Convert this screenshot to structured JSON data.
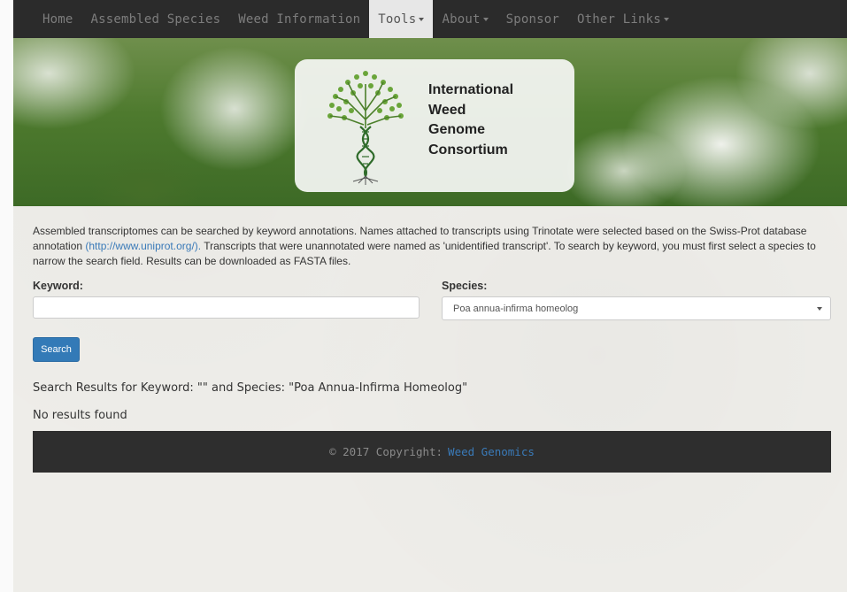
{
  "nav": {
    "items": [
      {
        "label": "Home",
        "dropdown": false
      },
      {
        "label": "Assembled Species",
        "dropdown": false
      },
      {
        "label": "Weed Information",
        "dropdown": false
      },
      {
        "label": "Tools",
        "dropdown": true,
        "active": true
      },
      {
        "label": "About",
        "dropdown": true
      },
      {
        "label": "Sponsor",
        "dropdown": false
      },
      {
        "label": "Other Links",
        "dropdown": true
      }
    ]
  },
  "banner": {
    "logo_lines": [
      "International",
      "Weed",
      "Genome",
      "Consortium"
    ]
  },
  "intro": {
    "text_before_link": "Assembled transcriptomes can be searched by keyword annotations. Names attached to transcripts using Trinotate were selected based on the Swiss-Prot database annotation ",
    "link_text": "(http://www.uniprot.org/).",
    "text_after_link": " Transcripts that were unannotated were named as 'unidentified transcript'. To search by keyword, you must first select a species to narrow the search field. Results can be downloaded as FASTA files."
  },
  "form": {
    "keyword_label": "Keyword:",
    "keyword_value": "",
    "species_label": "Species:",
    "species_selected": "Poa annua-infirma homeolog",
    "search_button": "Search"
  },
  "results": {
    "title": "Search Results for Keyword: \"\" and Species: \"Poa Annua-Infirma Homeolog\"",
    "empty_message": "No results found"
  },
  "footer": {
    "copyright": "© 2017 Copyright:",
    "link_text": "Weed Genomics"
  },
  "colors": {
    "navbar_bg": "#2b2b2b",
    "accent": "#337ab7",
    "link": "#3a7ab8",
    "footer_bg": "#2e2e2e"
  }
}
